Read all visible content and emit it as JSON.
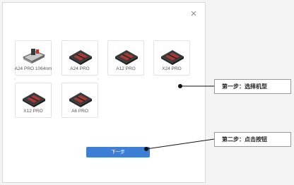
{
  "dialog": {
    "close_glyph": "×",
    "models": [
      {
        "label": "A24 PRO 1064nm",
        "icon": "laser-module-icon"
      },
      {
        "label": "A24 PRO",
        "icon": "laser-machine-icon"
      },
      {
        "label": "A12 PRO",
        "icon": "laser-machine-icon"
      },
      {
        "label": "X24 PRO",
        "icon": "laser-machine-icon"
      },
      {
        "label": "X12 PRO",
        "icon": "laser-machine-icon"
      },
      {
        "label": "A6 PRO",
        "icon": "laser-machine-icon"
      }
    ],
    "next_label": "下一步"
  },
  "callouts": {
    "step1": "第一步：选择机型",
    "step2": "第二步：点击按钮"
  },
  "colors": {
    "button": "#3d7fd4",
    "machine_body": "#3a3a3a",
    "machine_accent": "#c2332e"
  }
}
